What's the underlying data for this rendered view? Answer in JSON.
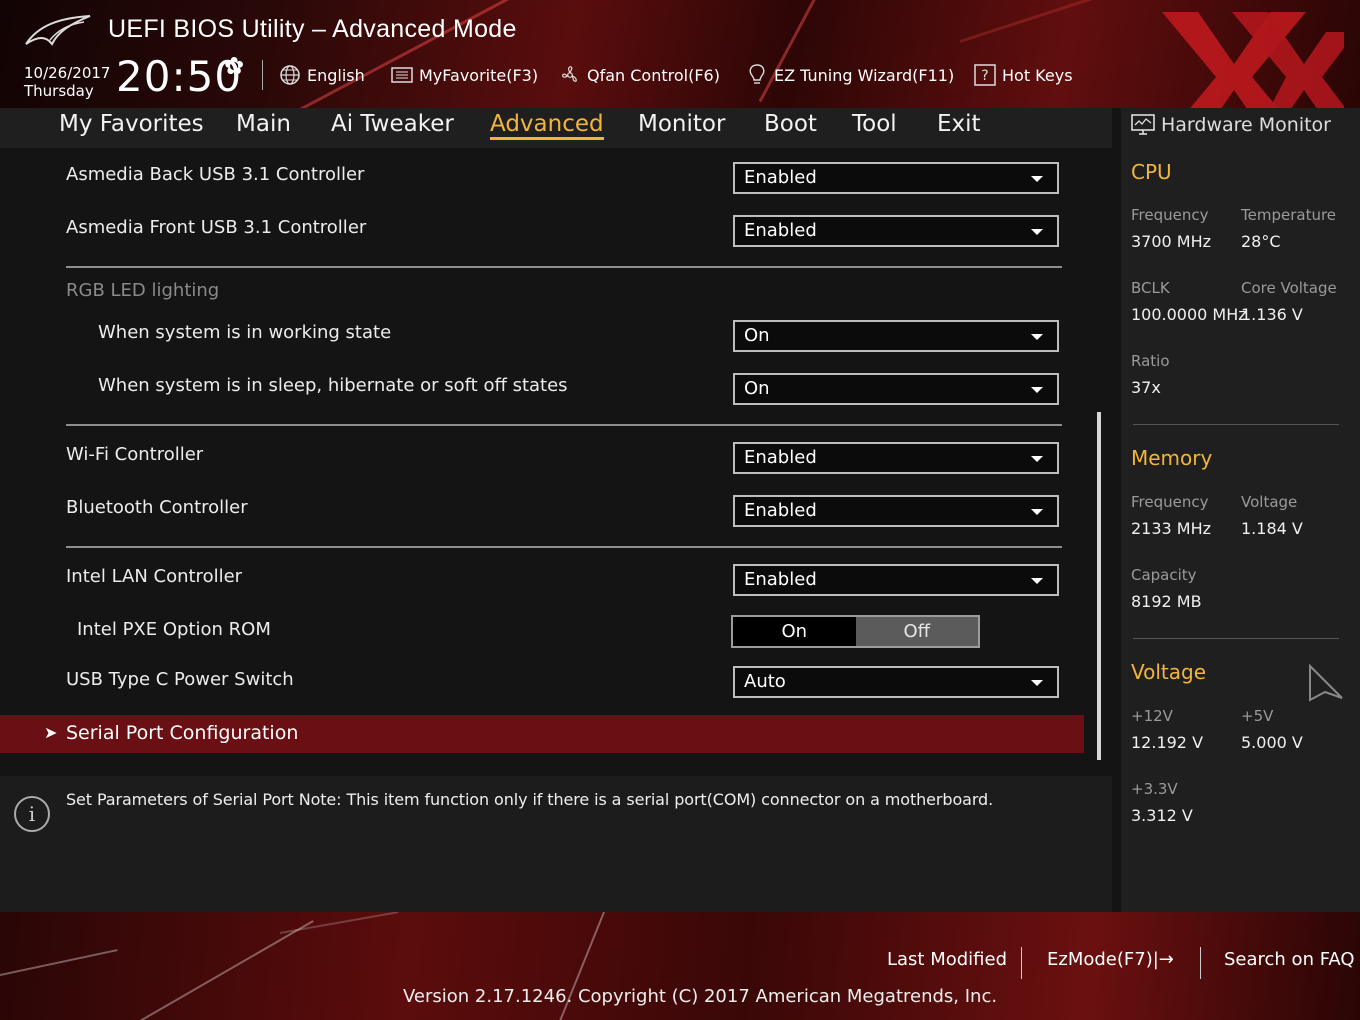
{
  "header": {
    "title": "UEFI BIOS Utility – Advanced Mode",
    "date": "10/26/2017",
    "weekday": "Thursday",
    "time": "20:50",
    "toolbar": [
      {
        "label": "English",
        "icon": "globe-icon"
      },
      {
        "label": "MyFavorite(F3)",
        "icon": "favorite-list-icon"
      },
      {
        "label": "Qfan Control(F6)",
        "icon": "fan-icon"
      },
      {
        "label": "EZ Tuning Wizard(F11)",
        "icon": "lightbulb-icon"
      },
      {
        "label": "Hot Keys",
        "icon": "help-icon"
      }
    ]
  },
  "tabs": [
    "My Favorites",
    "Main",
    "Ai Tweaker",
    "Advanced",
    "Monitor",
    "Boot",
    "Tool",
    "Exit"
  ],
  "active_tab": "Advanced",
  "settings": {
    "asmedia_back": {
      "label": "Asmedia Back USB 3.1 Controller",
      "value": "Enabled"
    },
    "asmedia_front": {
      "label": "Asmedia Front USB 3.1 Controller",
      "value": "Enabled"
    },
    "rgb_header": "RGB LED lighting",
    "rgb_working": {
      "label": "When system is in working state",
      "value": "On"
    },
    "rgb_sleep": {
      "label": "When system is in sleep, hibernate or soft off states",
      "value": "On"
    },
    "wifi": {
      "label": "Wi-Fi Controller",
      "value": "Enabled"
    },
    "bluetooth": {
      "label": "Bluetooth Controller",
      "value": "Enabled"
    },
    "intel_lan": {
      "label": "Intel LAN Controller",
      "value": "Enabled"
    },
    "pxe": {
      "label": "Intel PXE Option ROM",
      "on": "On",
      "off": "Off",
      "selected": "Off"
    },
    "usb_c": {
      "label": "USB Type C Power Switch",
      "value": "Auto"
    },
    "serial_port": {
      "label": "Serial Port Configuration"
    }
  },
  "info_text": "Set Parameters of Serial Port  Note: This item function only if there is a serial port(COM) connector on a motherboard.",
  "hardware_monitor": {
    "title": "Hardware Monitor",
    "cpu": {
      "heading": "CPU",
      "frequency_label": "Frequency",
      "frequency": "3700 MHz",
      "temperature_label": "Temperature",
      "temperature": "28°C",
      "bclk_label": "BCLK",
      "bclk": "100.0000 MHz",
      "core_voltage_label": "Core Voltage",
      "core_voltage": "1.136 V",
      "ratio_label": "Ratio",
      "ratio": "37x"
    },
    "memory": {
      "heading": "Memory",
      "frequency_label": "Frequency",
      "frequency": "2133 MHz",
      "voltage_label": "Voltage",
      "voltage": "1.184 V",
      "capacity_label": "Capacity",
      "capacity": "8192 MB"
    },
    "voltage": {
      "heading": "Voltage",
      "v12_label": "+12V",
      "v12": "12.192 V",
      "v5_label": "+5V",
      "v5": "5.000 V",
      "v33_label": "+3.3V",
      "v33": "3.312 V"
    }
  },
  "footer": {
    "last_modified": "Last Modified",
    "ezmode": "EzMode(F7)|→",
    "search_faq": "Search on FAQ",
    "version": "Version 2.17.1246. Copyright (C) 2017 American Megatrends, Inc."
  },
  "colors": {
    "accent": "#f2b53b",
    "selected_row": "#6a0f13",
    "header_red": "#5a0d0d"
  }
}
